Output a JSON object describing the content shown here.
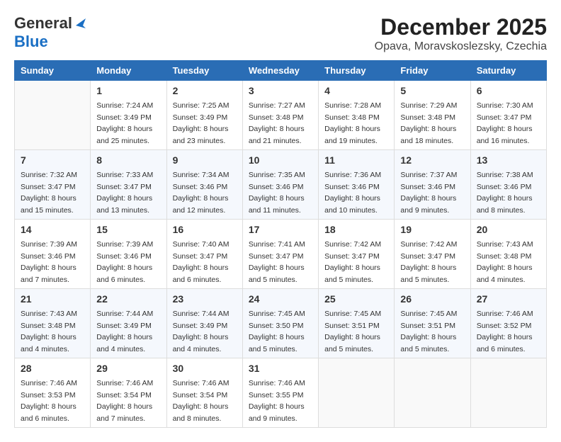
{
  "header": {
    "logo_line1": "General",
    "logo_line2": "Blue",
    "title": "December 2025",
    "subtitle": "Opava, Moravskoslezsky, Czechia"
  },
  "days_of_week": [
    "Sunday",
    "Monday",
    "Tuesday",
    "Wednesday",
    "Thursday",
    "Friday",
    "Saturday"
  ],
  "weeks": [
    [
      {
        "day": "",
        "sunrise": "",
        "sunset": "",
        "daylight": "",
        "empty": true
      },
      {
        "day": "1",
        "sunrise": "Sunrise: 7:24 AM",
        "sunset": "Sunset: 3:49 PM",
        "daylight": "Daylight: 8 hours and 25 minutes."
      },
      {
        "day": "2",
        "sunrise": "Sunrise: 7:25 AM",
        "sunset": "Sunset: 3:49 PM",
        "daylight": "Daylight: 8 hours and 23 minutes."
      },
      {
        "day": "3",
        "sunrise": "Sunrise: 7:27 AM",
        "sunset": "Sunset: 3:48 PM",
        "daylight": "Daylight: 8 hours and 21 minutes."
      },
      {
        "day": "4",
        "sunrise": "Sunrise: 7:28 AM",
        "sunset": "Sunset: 3:48 PM",
        "daylight": "Daylight: 8 hours and 19 minutes."
      },
      {
        "day": "5",
        "sunrise": "Sunrise: 7:29 AM",
        "sunset": "Sunset: 3:48 PM",
        "daylight": "Daylight: 8 hours and 18 minutes."
      },
      {
        "day": "6",
        "sunrise": "Sunrise: 7:30 AM",
        "sunset": "Sunset: 3:47 PM",
        "daylight": "Daylight: 8 hours and 16 minutes."
      }
    ],
    [
      {
        "day": "7",
        "sunrise": "Sunrise: 7:32 AM",
        "sunset": "Sunset: 3:47 PM",
        "daylight": "Daylight: 8 hours and 15 minutes."
      },
      {
        "day": "8",
        "sunrise": "Sunrise: 7:33 AM",
        "sunset": "Sunset: 3:47 PM",
        "daylight": "Daylight: 8 hours and 13 minutes."
      },
      {
        "day": "9",
        "sunrise": "Sunrise: 7:34 AM",
        "sunset": "Sunset: 3:46 PM",
        "daylight": "Daylight: 8 hours and 12 minutes."
      },
      {
        "day": "10",
        "sunrise": "Sunrise: 7:35 AM",
        "sunset": "Sunset: 3:46 PM",
        "daylight": "Daylight: 8 hours and 11 minutes."
      },
      {
        "day": "11",
        "sunrise": "Sunrise: 7:36 AM",
        "sunset": "Sunset: 3:46 PM",
        "daylight": "Daylight: 8 hours and 10 minutes."
      },
      {
        "day": "12",
        "sunrise": "Sunrise: 7:37 AM",
        "sunset": "Sunset: 3:46 PM",
        "daylight": "Daylight: 8 hours and 9 minutes."
      },
      {
        "day": "13",
        "sunrise": "Sunrise: 7:38 AM",
        "sunset": "Sunset: 3:46 PM",
        "daylight": "Daylight: 8 hours and 8 minutes."
      }
    ],
    [
      {
        "day": "14",
        "sunrise": "Sunrise: 7:39 AM",
        "sunset": "Sunset: 3:46 PM",
        "daylight": "Daylight: 8 hours and 7 minutes."
      },
      {
        "day": "15",
        "sunrise": "Sunrise: 7:39 AM",
        "sunset": "Sunset: 3:46 PM",
        "daylight": "Daylight: 8 hours and 6 minutes."
      },
      {
        "day": "16",
        "sunrise": "Sunrise: 7:40 AM",
        "sunset": "Sunset: 3:47 PM",
        "daylight": "Daylight: 8 hours and 6 minutes."
      },
      {
        "day": "17",
        "sunrise": "Sunrise: 7:41 AM",
        "sunset": "Sunset: 3:47 PM",
        "daylight": "Daylight: 8 hours and 5 minutes."
      },
      {
        "day": "18",
        "sunrise": "Sunrise: 7:42 AM",
        "sunset": "Sunset: 3:47 PM",
        "daylight": "Daylight: 8 hours and 5 minutes."
      },
      {
        "day": "19",
        "sunrise": "Sunrise: 7:42 AM",
        "sunset": "Sunset: 3:47 PM",
        "daylight": "Daylight: 8 hours and 5 minutes."
      },
      {
        "day": "20",
        "sunrise": "Sunrise: 7:43 AM",
        "sunset": "Sunset: 3:48 PM",
        "daylight": "Daylight: 8 hours and 4 minutes."
      }
    ],
    [
      {
        "day": "21",
        "sunrise": "Sunrise: 7:43 AM",
        "sunset": "Sunset: 3:48 PM",
        "daylight": "Daylight: 8 hours and 4 minutes."
      },
      {
        "day": "22",
        "sunrise": "Sunrise: 7:44 AM",
        "sunset": "Sunset: 3:49 PM",
        "daylight": "Daylight: 8 hours and 4 minutes."
      },
      {
        "day": "23",
        "sunrise": "Sunrise: 7:44 AM",
        "sunset": "Sunset: 3:49 PM",
        "daylight": "Daylight: 8 hours and 4 minutes."
      },
      {
        "day": "24",
        "sunrise": "Sunrise: 7:45 AM",
        "sunset": "Sunset: 3:50 PM",
        "daylight": "Daylight: 8 hours and 5 minutes."
      },
      {
        "day": "25",
        "sunrise": "Sunrise: 7:45 AM",
        "sunset": "Sunset: 3:51 PM",
        "daylight": "Daylight: 8 hours and 5 minutes."
      },
      {
        "day": "26",
        "sunrise": "Sunrise: 7:45 AM",
        "sunset": "Sunset: 3:51 PM",
        "daylight": "Daylight: 8 hours and 5 minutes."
      },
      {
        "day": "27",
        "sunrise": "Sunrise: 7:46 AM",
        "sunset": "Sunset: 3:52 PM",
        "daylight": "Daylight: 8 hours and 6 minutes."
      }
    ],
    [
      {
        "day": "28",
        "sunrise": "Sunrise: 7:46 AM",
        "sunset": "Sunset: 3:53 PM",
        "daylight": "Daylight: 8 hours and 6 minutes."
      },
      {
        "day": "29",
        "sunrise": "Sunrise: 7:46 AM",
        "sunset": "Sunset: 3:54 PM",
        "daylight": "Daylight: 8 hours and 7 minutes."
      },
      {
        "day": "30",
        "sunrise": "Sunrise: 7:46 AM",
        "sunset": "Sunset: 3:54 PM",
        "daylight": "Daylight: 8 hours and 8 minutes."
      },
      {
        "day": "31",
        "sunrise": "Sunrise: 7:46 AM",
        "sunset": "Sunset: 3:55 PM",
        "daylight": "Daylight: 8 hours and 9 minutes."
      },
      {
        "day": "",
        "sunrise": "",
        "sunset": "",
        "daylight": "",
        "empty": true
      },
      {
        "day": "",
        "sunrise": "",
        "sunset": "",
        "daylight": "",
        "empty": true
      },
      {
        "day": "",
        "sunrise": "",
        "sunset": "",
        "daylight": "",
        "empty": true
      }
    ]
  ]
}
